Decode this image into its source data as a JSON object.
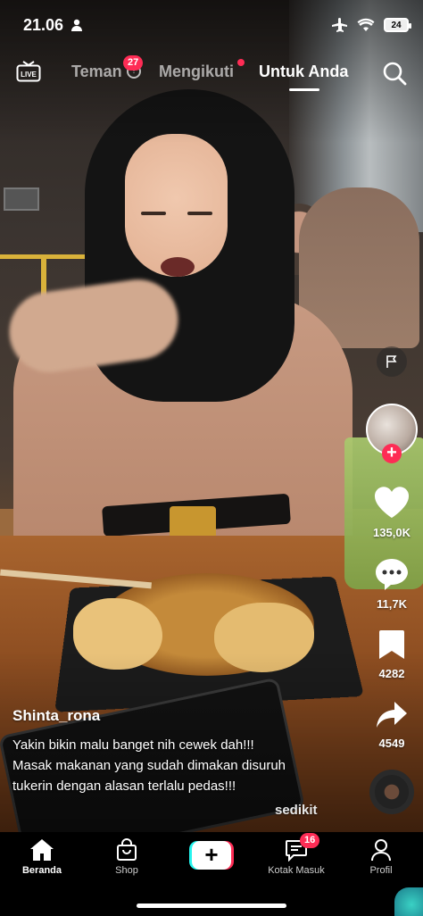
{
  "status_bar": {
    "time": "21.06",
    "battery": "24"
  },
  "top_nav": {
    "live_label": "LIVE",
    "tabs": [
      {
        "label": "Teman",
        "badge": "27"
      },
      {
        "label": "Mengikuti"
      },
      {
        "label": "Untuk Anda",
        "active": true
      }
    ]
  },
  "post": {
    "username": "Shinta_rona",
    "caption_lines": [
      "Yakin bikin malu banget nih cewek dah!!!",
      "Masak makanan yang sudah dimakan disuruh",
      "tukerin dengan alasan terlalu pedas!!!"
    ],
    "more_label": "sedikit"
  },
  "actions": {
    "likes": "135,0K",
    "comments": "11,7K",
    "saves": "4282",
    "shares": "4549"
  },
  "bottom_nav": {
    "items": [
      {
        "label": "Beranda",
        "icon": "home-icon",
        "active": true
      },
      {
        "label": "Shop",
        "icon": "shop-bag-icon"
      },
      {
        "label": "",
        "icon": "create-plus-icon"
      },
      {
        "label": "Kotak Masuk",
        "icon": "inbox-icon",
        "badge": "16"
      },
      {
        "label": "Profil",
        "icon": "profile-icon"
      }
    ]
  },
  "colors": {
    "accent_red": "#fe2c55",
    "accent_cyan": "#25f4ee"
  }
}
